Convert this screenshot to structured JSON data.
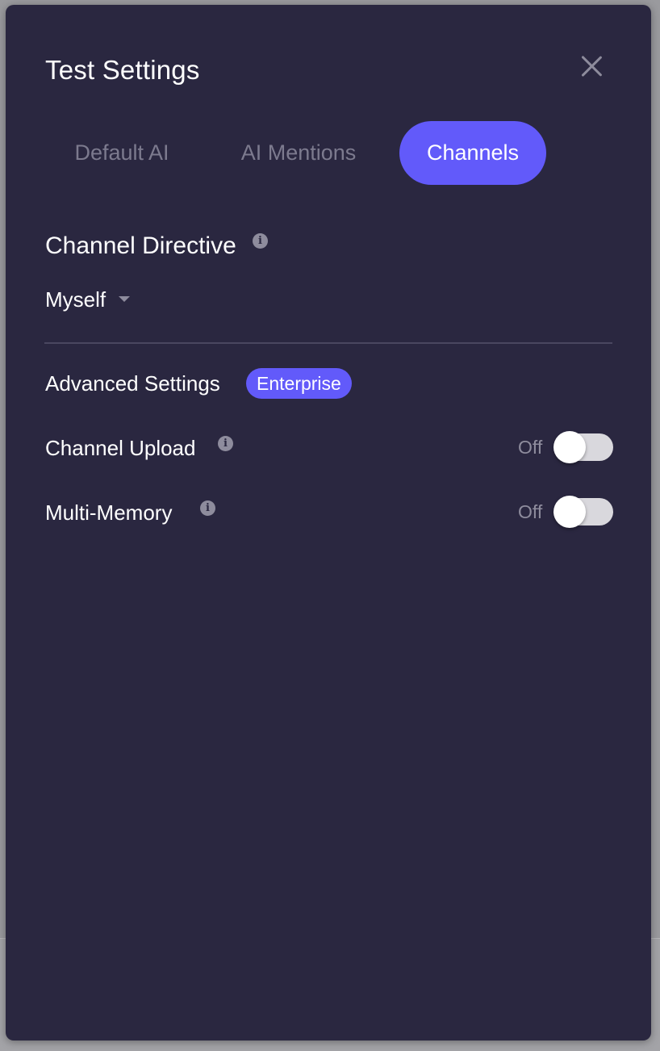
{
  "modal": {
    "title": "Test Settings",
    "close_icon": "close-icon"
  },
  "tabs": [
    {
      "label": "Default AI",
      "active": false
    },
    {
      "label": "AI Mentions",
      "active": false
    },
    {
      "label": "Channels",
      "active": true
    }
  ],
  "channel_directive": {
    "title": "Channel Directive",
    "info_icon": "info-icon",
    "selected": "Myself",
    "dropdown_icon": "caret-down-icon"
  },
  "advanced": {
    "title": "Advanced Settings",
    "badge": "Enterprise",
    "badge_color": "#625afa"
  },
  "settings": [
    {
      "label": "Channel Upload",
      "state": "Off",
      "enabled": false
    },
    {
      "label": "Multi-Memory",
      "state": "Off",
      "enabled": false
    }
  ],
  "colors": {
    "modal_bg": "#2a2740",
    "accent": "#625afa",
    "muted_text": "#7c7a8e"
  }
}
